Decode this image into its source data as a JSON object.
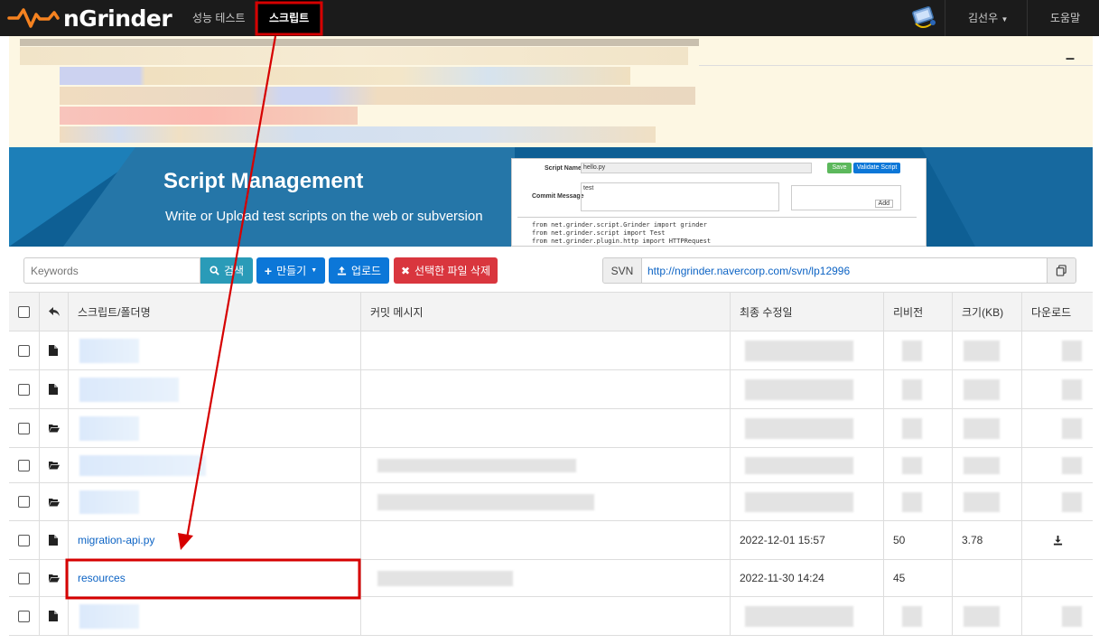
{
  "navbar": {
    "brand": "nGrinder",
    "nav_perf_test": "성능 테스트",
    "nav_script": "스크립트",
    "user_name": "김선우",
    "help": "도움말"
  },
  "notice": {
    "collapse": "–"
  },
  "banner": {
    "title": "Script Management",
    "subtitle": "Write or Upload test scripts on the web or subversion",
    "mock_script_name_label": "Script Name",
    "mock_script_name": "hello.py",
    "mock_save": "Save",
    "mock_validate": "Validate Script",
    "mock_commit_label": "Commit Message",
    "mock_commit": "test",
    "mock_add": "Add",
    "mock_code": [
      "from net.grinder.script.Grinder import grinder",
      "from net.grinder.script import Test",
      "from net.grinder.plugin.http import HTTPRequest"
    ]
  },
  "toolbar": {
    "search_placeholder": "Keywords",
    "search_btn": "검색",
    "create_btn": "만들기",
    "upload_btn": "업로드",
    "delete_btn": "선택한 파일 삭제",
    "svn_label": "SVN",
    "svn_url": "http://ngrinder.navercorp.com/svn/lp12996"
  },
  "table": {
    "columns": {
      "name": "스크립트/폴더명",
      "commit": "커밋 메시지",
      "modified": "최종 수정일",
      "revision": "리비전",
      "size": "크기(KB)",
      "download": "다운로드"
    },
    "rows": [
      {
        "type": "file",
        "name": "",
        "modified": "",
        "revision": "",
        "size": ""
      },
      {
        "type": "file",
        "name": "",
        "modified": "",
        "revision": "",
        "size": ""
      },
      {
        "type": "folder",
        "name": "",
        "modified": "",
        "revision": "",
        "size": ""
      },
      {
        "type": "folder",
        "name": "",
        "modified": "",
        "revision": "",
        "size": ""
      },
      {
        "type": "folder",
        "name": "",
        "modified": "",
        "revision": "",
        "size": ""
      },
      {
        "type": "file",
        "name": "migration-api.py",
        "modified": "2022-12-01 15:57",
        "revision": "50",
        "size": "3.78"
      },
      {
        "type": "folder",
        "name": "resources",
        "modified": "2022-11-30 14:24",
        "revision": "45",
        "size": ""
      },
      {
        "type": "file",
        "name": "",
        "modified": "",
        "revision": "",
        "size": ""
      }
    ]
  },
  "colors": {
    "navbar": "#1b1b1b",
    "brand_orange": "#f58220",
    "link": "#0c63c4",
    "annotation_red": "#d60000",
    "banner": "#0e5f94"
  }
}
